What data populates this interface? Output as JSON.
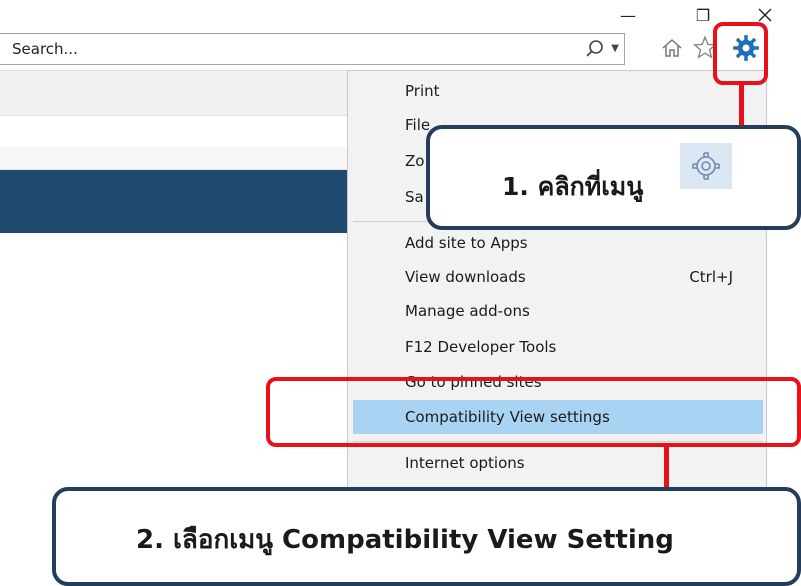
{
  "window": {
    "minimize_glyph": "—",
    "restore_glyph": "❐"
  },
  "search": {
    "placeholder": "Search...",
    "icon": "search-icon"
  },
  "toolbar": {
    "icons": [
      "home-icon",
      "star-icon",
      "gear-icon"
    ]
  },
  "menu": {
    "items": [
      {
        "label": "Print"
      },
      {
        "label": "File"
      },
      {
        "label": "Zo"
      },
      {
        "label": "Sa"
      },
      {
        "label": "Add site to Apps"
      },
      {
        "label": "View downloads",
        "shortcut": "Ctrl+J"
      },
      {
        "label": "Manage add-ons"
      },
      {
        "label": "F12 Developer Tools"
      },
      {
        "label": "Go to pinned sites"
      },
      {
        "label": "Compatibility View settings"
      },
      {
        "label": "Internet options"
      }
    ]
  },
  "callouts": {
    "step1": "1. คลิกที่เมนู",
    "step2": "2. เลือกเมนู Compatibility View Setting"
  },
  "colors": {
    "highlight": "#a8d3f3",
    "callout_border": "#243d5a",
    "annotation_red": "#e8101a",
    "page_bar": "#1f4a6e"
  }
}
